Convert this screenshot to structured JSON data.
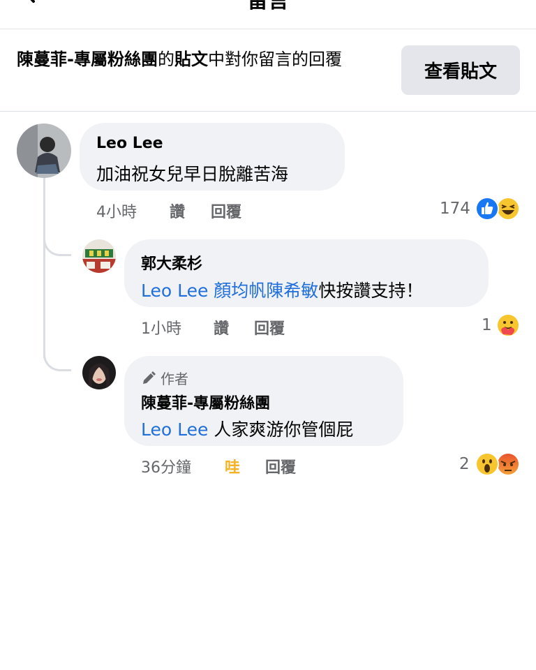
{
  "header": {
    "title": "留言"
  },
  "banner": {
    "page_name": "陳蔓菲-專屬粉絲團",
    "text_1": "的",
    "post_word": "貼文",
    "text_2": "中對你留言的回覆",
    "view_post_label": "查看貼文"
  },
  "comments": [
    {
      "author": "Leo Lee",
      "text": "加油祝女兒早日脫離苦海",
      "time": "4小時",
      "like_label": "讚",
      "reply_label": "回覆",
      "reaction_count": "174",
      "reactions": [
        "like-icon",
        "haha-icon"
      ]
    },
    {
      "author": "郭大柔杉",
      "mention": "Leo Lee 顏均帆陳希敏",
      "text": "快按讚支持！",
      "time": "1小時",
      "like_label": "讚",
      "reply_label": "回覆",
      "reaction_count": "1",
      "reactions": [
        "care-icon"
      ]
    },
    {
      "badge": "作者",
      "author": "陳蔓菲-專屬粉絲團",
      "mention": "Leo Lee",
      "text": "人家爽游你管個屁",
      "time": "36分鐘",
      "like_label": "哇",
      "reply_label": "回覆",
      "reaction_count": "2",
      "reactions": [
        "wow-icon",
        "angry-icon"
      ]
    }
  ],
  "colors": {
    "mention": "#216fdb",
    "wow_label": "#f7b125",
    "bubble": "#f0f2f5",
    "button": "#e4e6eb"
  }
}
